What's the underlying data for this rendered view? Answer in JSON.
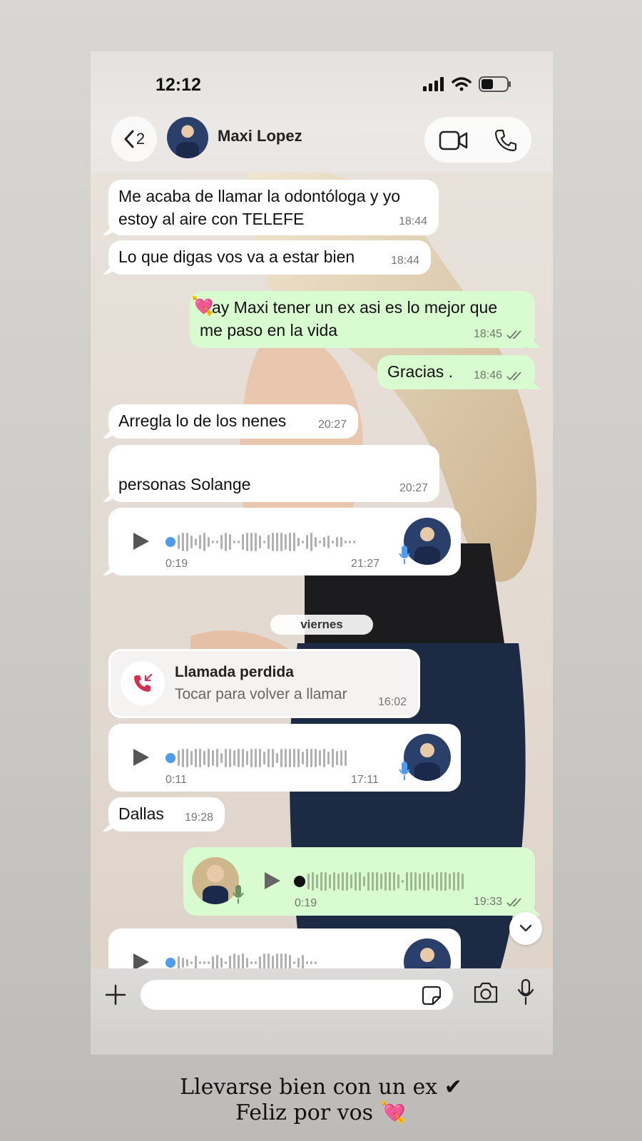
{
  "status_bar": {
    "time": "12:12"
  },
  "header": {
    "back_count": "2",
    "contact_name": "Maxi Lopez"
  },
  "messages": [
    {
      "dir": "in",
      "text_line1": "Me acaba de llamar la odontóloga y yo",
      "text_line2": "estoy al aire con TELEFE",
      "time": "18:44"
    },
    {
      "dir": "in",
      "text": "Lo que digas vos va a estar bien",
      "time": "18:44"
    },
    {
      "dir": "out",
      "emoji": "💘",
      "text_line1": "ay Maxi tener un ex asi es lo mejor que",
      "text_line2": "me paso en la vida",
      "time": "18:45"
    },
    {
      "dir": "out",
      "text": "Gracias .",
      "time": "18:46"
    },
    {
      "dir": "in",
      "text": "Arregla lo de los nenes",
      "time": "20:27"
    },
    {
      "dir": "in",
      "text": "personas Solange",
      "time": "20:27"
    },
    {
      "dir": "in",
      "type": "voice",
      "duration": "0:19",
      "time": "21:27"
    }
  ],
  "day_separator": "viernes",
  "missed_call": {
    "title": "Llamada perdida",
    "subtitle": "Tocar para volver a llamar",
    "time": "16:02"
  },
  "messages2": [
    {
      "dir": "in",
      "type": "voice",
      "duration": "0:11",
      "time": "17:11"
    },
    {
      "dir": "in",
      "text": "Dallas",
      "time": "19:28"
    },
    {
      "dir": "out",
      "type": "voice",
      "duration": "0:19",
      "time": "19:33"
    }
  ],
  "caption": {
    "line1": "Llevarse bien con un ex ✔",
    "line2": "Feliz por vos 💘"
  },
  "icons": {
    "back": "chevron-left-icon",
    "video": "video-camera-icon",
    "phone": "phone-icon",
    "play": "play-icon",
    "mic": "microphone-icon",
    "add": "plus-icon",
    "sticker": "sticker-icon",
    "camera": "camera-icon",
    "missed": "missed-call-icon",
    "scroll": "chevron-down-icon",
    "read": "double-check-icon"
  },
  "colors": {
    "outgoing_bubble": "#d9fbd0",
    "incoming_bubble": "#ffffff",
    "missed_call": "#d6304f",
    "voice_dot": "#4a9df0"
  }
}
